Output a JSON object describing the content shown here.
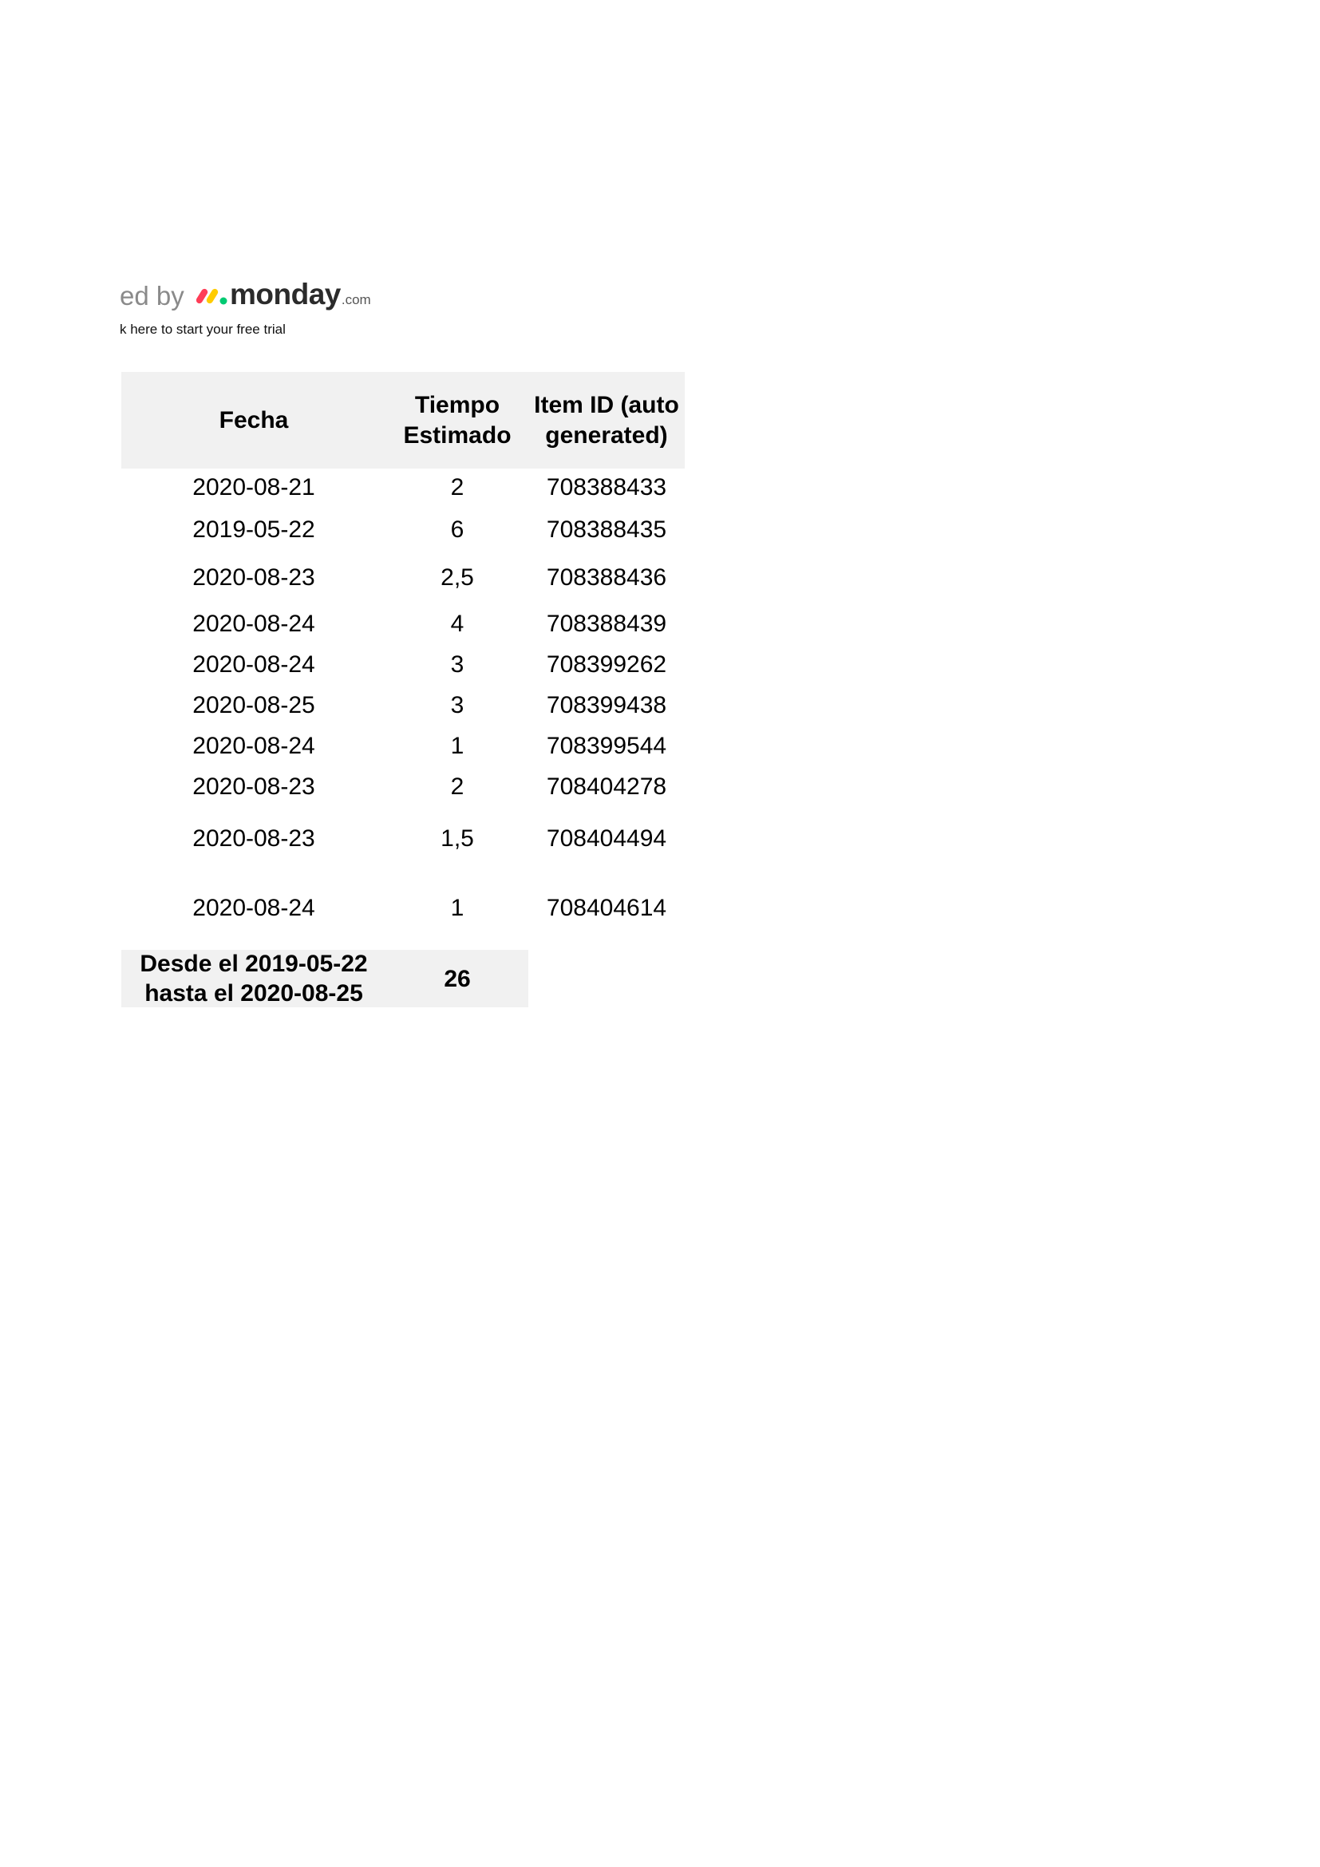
{
  "branding": {
    "powered_text": "ed by",
    "logo_word": "monday",
    "logo_suffix": ".com",
    "trial_link": "k here to start your free trial",
    "logo_colors": [
      "#ff3d57",
      "#ffcb00",
      "#00ca72"
    ]
  },
  "table": {
    "headers": [
      "Fecha",
      "Tiempo Estimado",
      "Item ID (auto generated)"
    ],
    "header_lines": {
      "fecha": "Fecha",
      "tiempo_1": "Tiempo",
      "tiempo_2": "Estimado",
      "item_1": "Item ID (auto",
      "item_2": "generated)"
    },
    "rows": [
      {
        "fecha": "2020-08-21",
        "tiempo": "2",
        "item_id": "708388433"
      },
      {
        "fecha": "2019-05-22",
        "tiempo": "6",
        "item_id": "708388435"
      },
      {
        "fecha": "2020-08-23",
        "tiempo": "2,5",
        "item_id": "708388436"
      },
      {
        "fecha": "2020-08-24",
        "tiempo": "4",
        "item_id": "708388439"
      },
      {
        "fecha": "2020-08-24",
        "tiempo": "3",
        "item_id": "708399262"
      },
      {
        "fecha": "2020-08-25",
        "tiempo": "3",
        "item_id": "708399438"
      },
      {
        "fecha": "2020-08-24",
        "tiempo": "1",
        "item_id": "708399544"
      },
      {
        "fecha": "2020-08-23",
        "tiempo": "2",
        "item_id": "708404278"
      },
      {
        "fecha": "2020-08-23",
        "tiempo": "1,5",
        "item_id": "708404494"
      },
      {
        "fecha": "2020-08-24",
        "tiempo": "1",
        "item_id": "708404614"
      }
    ],
    "summary": {
      "range_line_1": "Desde el 2019-05-22",
      "range_line_2": "hasta el 2020-08-25",
      "total": "26"
    }
  }
}
